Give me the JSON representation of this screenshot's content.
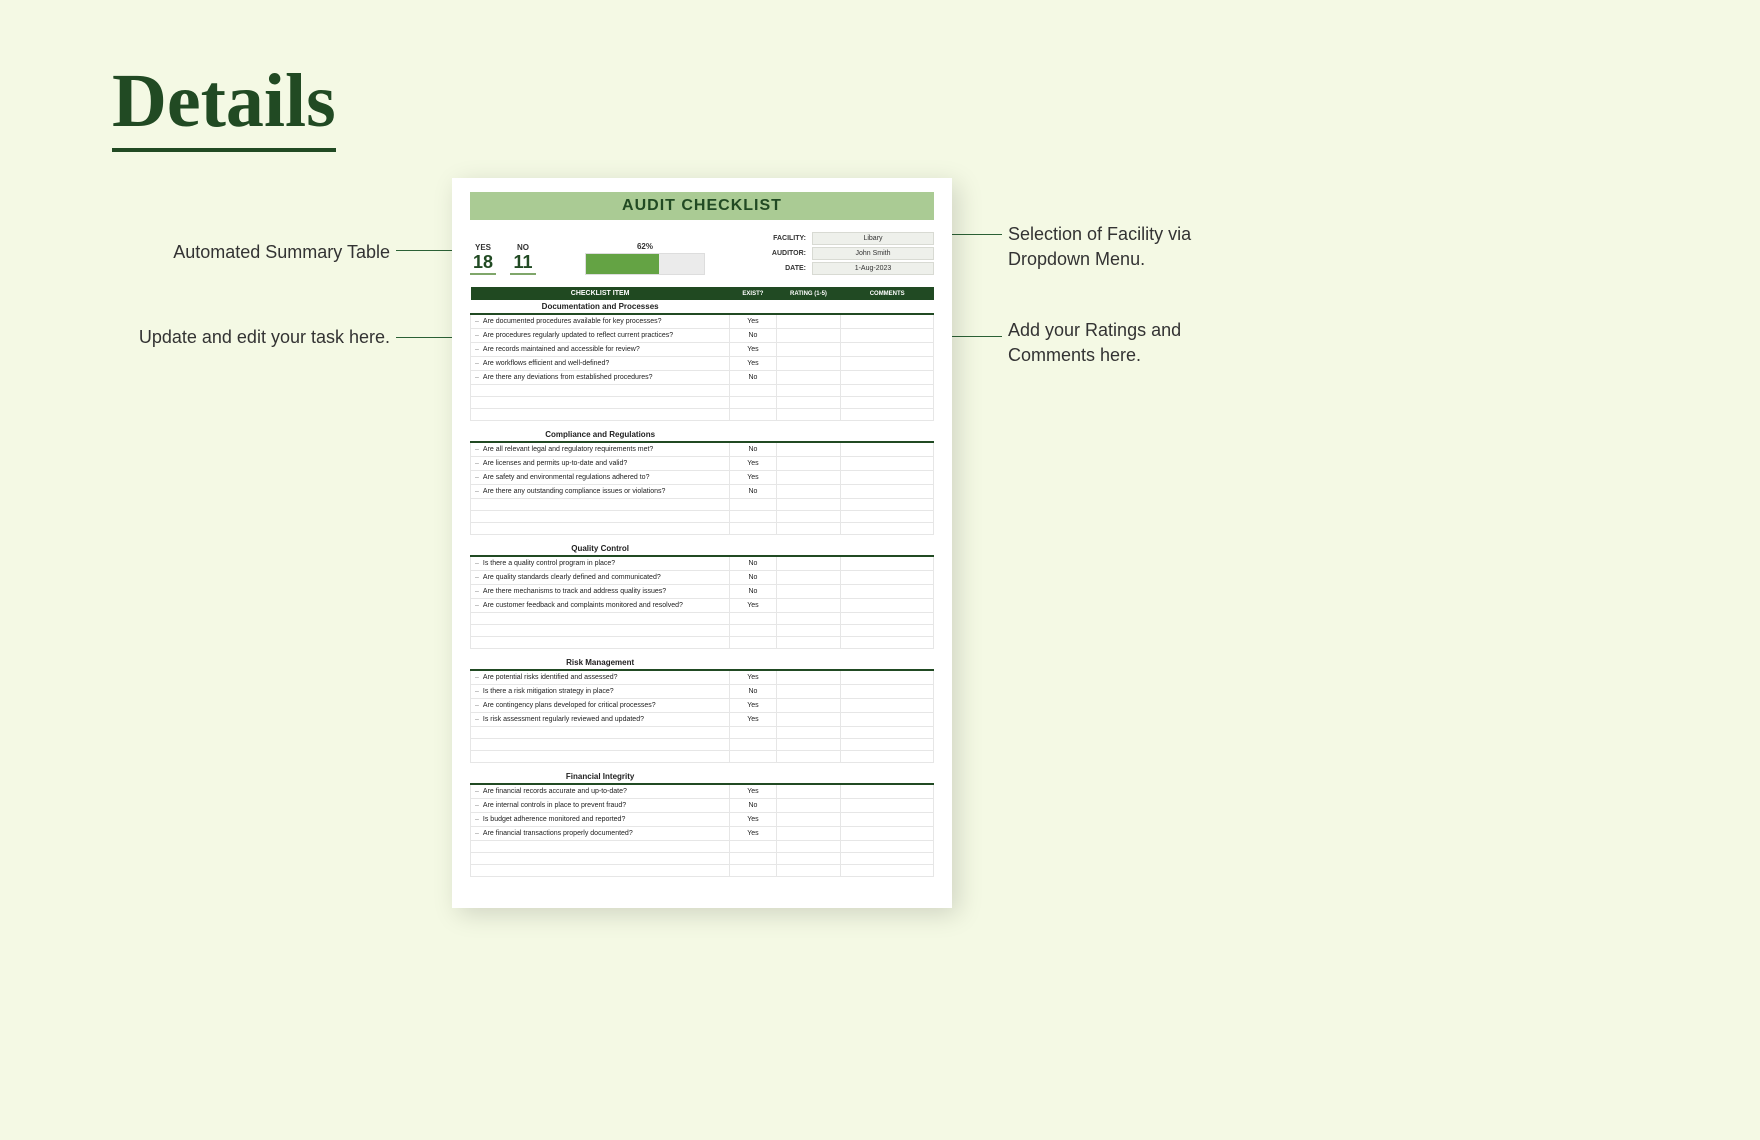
{
  "page": {
    "title": "Details"
  },
  "doc": {
    "title": "AUDIT CHECKLIST",
    "summary": {
      "yes_label": "YES",
      "yes": "18",
      "no_label": "NO",
      "no": "11",
      "pct_label": "62%",
      "pct_fill": 62
    },
    "meta": {
      "facility_label": "FACILITY:",
      "facility": "Libary",
      "auditor_label": "AUDITOR:",
      "auditor": "John Smith",
      "date_label": "DATE:",
      "date": "1-Aug-2023"
    },
    "headers": {
      "item": "CHECKLIST ITEM",
      "exist": "EXIST?",
      "rating": "RATING (1-5)",
      "comments": "COMMENTS"
    },
    "sections": [
      {
        "name": "Documentation and Processes",
        "items": [
          {
            "q": "Are documented procedures available for key processes?",
            "exist": "Yes",
            "rating": "",
            "comments": ""
          },
          {
            "q": "Are procedures regularly updated to reflect current practices?",
            "exist": "No",
            "rating": "",
            "comments": ""
          },
          {
            "q": "Are records maintained and accessible for review?",
            "exist": "Yes",
            "rating": "",
            "comments": ""
          },
          {
            "q": "Are workflows efficient and well-defined?",
            "exist": "Yes",
            "rating": "",
            "comments": ""
          },
          {
            "q": "Are there any deviations from established procedures?",
            "exist": "No",
            "rating": "",
            "comments": ""
          }
        ],
        "blanks": 3
      },
      {
        "name": "Compliance and Regulations",
        "items": [
          {
            "q": "Are all relevant legal and regulatory requirements met?",
            "exist": "No",
            "rating": "",
            "comments": ""
          },
          {
            "q": "Are licenses and permits up-to-date and valid?",
            "exist": "Yes",
            "rating": "",
            "comments": ""
          },
          {
            "q": "Are safety and environmental regulations adhered to?",
            "exist": "Yes",
            "rating": "",
            "comments": ""
          },
          {
            "q": "Are there any outstanding compliance issues or violations?",
            "exist": "No",
            "rating": "",
            "comments": ""
          }
        ],
        "blanks": 3
      },
      {
        "name": "Quality Control",
        "items": [
          {
            "q": "Is there a quality control program in place?",
            "exist": "No",
            "rating": "",
            "comments": ""
          },
          {
            "q": "Are quality standards clearly defined and communicated?",
            "exist": "No",
            "rating": "",
            "comments": ""
          },
          {
            "q": "Are there mechanisms to track and address quality issues?",
            "exist": "No",
            "rating": "",
            "comments": ""
          },
          {
            "q": "Are customer feedback and complaints monitored and resolved?",
            "exist": "Yes",
            "rating": "",
            "comments": ""
          }
        ],
        "blanks": 3
      },
      {
        "name": "Risk Management",
        "items": [
          {
            "q": "Are potential risks identified and assessed?",
            "exist": "Yes",
            "rating": "",
            "comments": ""
          },
          {
            "q": "Is there a risk mitigation strategy in place?",
            "exist": "No",
            "rating": "",
            "comments": ""
          },
          {
            "q": "Are contingency plans developed for critical processes?",
            "exist": "Yes",
            "rating": "",
            "comments": ""
          },
          {
            "q": "Is risk assessment regularly reviewed and updated?",
            "exist": "Yes",
            "rating": "",
            "comments": ""
          }
        ],
        "blanks": 3
      },
      {
        "name": "Financial Integrity",
        "items": [
          {
            "q": "Are financial records accurate and up-to-date?",
            "exist": "Yes",
            "rating": "",
            "comments": ""
          },
          {
            "q": "Are internal controls in place to prevent fraud?",
            "exist": "No",
            "rating": "",
            "comments": ""
          },
          {
            "q": "Is budget adherence monitored and reported?",
            "exist": "Yes",
            "rating": "",
            "comments": ""
          },
          {
            "q": "Are financial transactions properly documented?",
            "exist": "Yes",
            "rating": "",
            "comments": ""
          }
        ],
        "blanks": 3
      }
    ]
  },
  "callouts": {
    "summary": "Automated Summary Table",
    "task": "Update and edit your task here.",
    "facility": "Selection of Facility via Dropdown Menu.",
    "ratings": "Add your Ratings and Comments here."
  }
}
